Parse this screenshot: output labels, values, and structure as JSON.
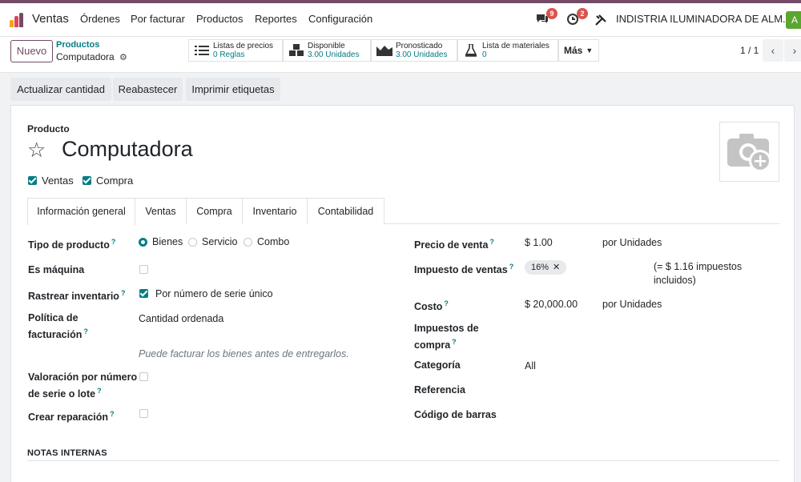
{
  "nav": {
    "app_name": "Ventas",
    "menu": [
      "Órdenes",
      "Por facturar",
      "Productos",
      "Reportes",
      "Configuración"
    ],
    "messages_count": "9",
    "activities_count": "2",
    "company": "INDISTRIA ILUMINADORA DE ALM...",
    "avatar_letter": "A"
  },
  "control": {
    "new_label": "Nuevo",
    "breadcrumb_parent": "Productos",
    "breadcrumb_current": "Computadora",
    "smart_buttons": [
      {
        "title": "Listas de precios",
        "value": "0 Reglas",
        "icon": "list-icon"
      },
      {
        "title": "Disponible",
        "value": "3.00 Unidades",
        "icon": "cubes-icon"
      },
      {
        "title": "Pronosticado",
        "value": "3.00 Unidades",
        "icon": "area-chart-icon"
      },
      {
        "title": "Lista de materiales",
        "value": "0",
        "icon": "flask-icon"
      }
    ],
    "more_label": "Más",
    "pager": "1 / 1"
  },
  "actions": [
    "Actualizar cantidad",
    "Reabastecer",
    "Imprimir etiquetas"
  ],
  "product": {
    "label": "Producto",
    "name": "Computadora",
    "flags": [
      {
        "label": "Ventas",
        "checked": true
      },
      {
        "label": "Compra",
        "checked": true
      }
    ]
  },
  "tabs": [
    "Información general",
    "Ventas",
    "Compra",
    "Inventario",
    "Contabilidad"
  ],
  "left_fields": {
    "tipo_producto": {
      "label": "Tipo de producto",
      "options": [
        "Bienes",
        "Servicio",
        "Combo"
      ],
      "selected": "Bienes"
    },
    "es_maquina": {
      "label": "Es máquina",
      "checked": false
    },
    "rastrear": {
      "label": "Rastrear inventario",
      "value": "Por número de serie único",
      "checked": true
    },
    "politica": {
      "label_1": "Política de",
      "label_2": "facturación",
      "value": "Cantidad ordenada",
      "hint": "Puede facturar los bienes antes de entregarlos."
    },
    "valoracion": {
      "label_1": "Valoración por número",
      "label_2": "de serie o lote",
      "checked": false
    },
    "reparacion": {
      "label": "Crear reparación",
      "checked": false
    }
  },
  "right_fields": {
    "precio": {
      "label": "Precio de venta",
      "value": "$ 1.00",
      "unit": "por Unidades"
    },
    "impuesto": {
      "label": "Impuesto de ventas",
      "tag": "16%",
      "note_1": "(= $ 1.16 impuestos",
      "note_2": "incluidos)"
    },
    "costo": {
      "label": "Costo",
      "value": "$ 20,000.00",
      "unit": "por Unidades"
    },
    "imp_compra": {
      "label_1": "Impuestos de",
      "label_2": "compra"
    },
    "categoria": {
      "label": "Categoría",
      "value": "All"
    },
    "referencia": {
      "label": "Referencia"
    },
    "codigo": {
      "label": "Código de barras"
    }
  },
  "help_mark": "?",
  "notes_title": "NOTAS INTERNAS",
  "colors": {
    "accent": "#714b67",
    "teal": "#017e84",
    "badge": "#d9534f",
    "avatar": "#5ba531"
  }
}
